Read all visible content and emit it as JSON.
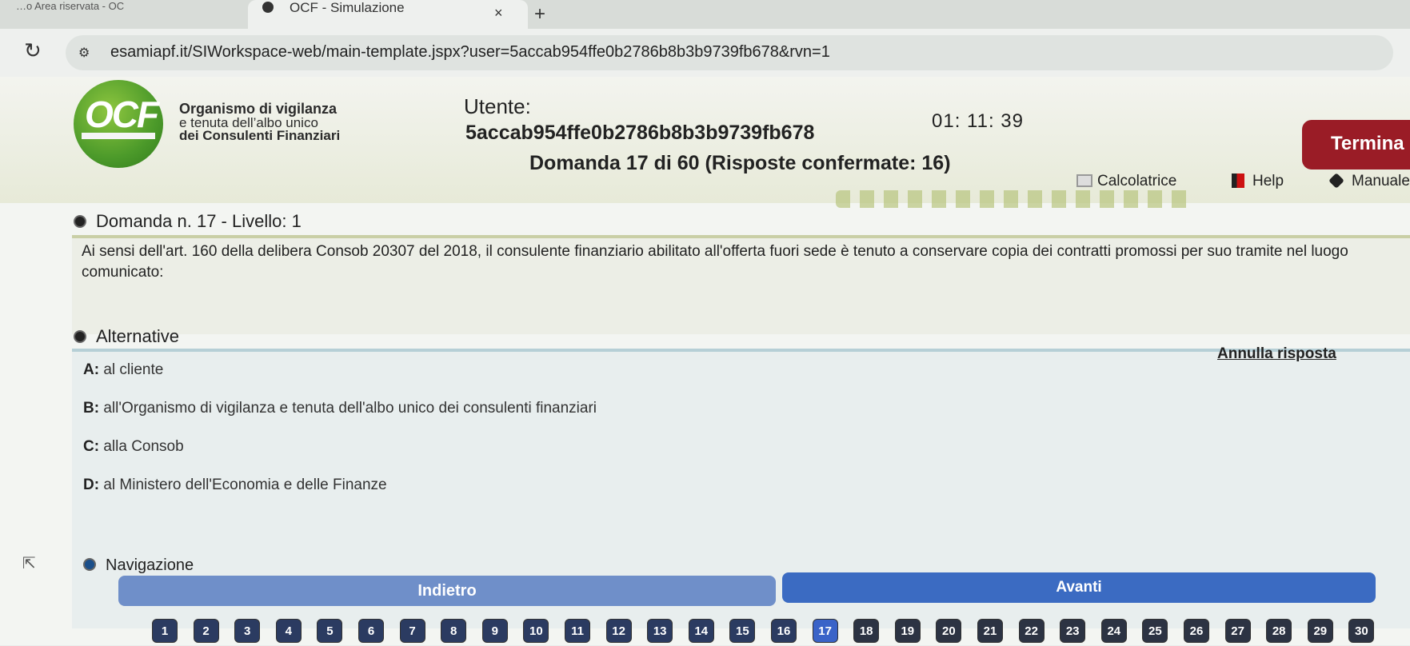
{
  "browser": {
    "prev_tab": "…o  Area riservata - OC",
    "tab_title": "OCF - Simulazione",
    "tab_close": "×",
    "new_tab": "+",
    "url": "esamiapf.it/SIWorkspace-web/main-template.jspx?user=5accab954ffe0b2786b8b3b9739fb678&rvn=1"
  },
  "header": {
    "logo_text": "OCF",
    "org_line1": "Organismo di vigilanza",
    "org_line2": "e tenuta dell’albo unico",
    "org_line3": "dei Consulenti Finanziari",
    "utente_label": "Utente:",
    "utente_id": "5accab954ffe0b2786b8b3b9739fb678",
    "timer": "01: 11: 39",
    "termina": "Termina",
    "domanda_title": "Domanda 17 di 60 (Risposte confermate: 16)",
    "tools": {
      "calcolatrice": "Calcolatrice",
      "help": "Help",
      "manuale": "Manuale"
    }
  },
  "question": {
    "heading": "Domanda n. 17 - Livello: 1",
    "text": "Ai sensi dell'art. 160 della delibera Consob 20307 del 2018, il consulente finanziario abilitato all'offerta fuori sede è tenuto a conservare copia dei contratti promossi per suo tramite nel luogo comunicato:"
  },
  "alternatives": {
    "heading": "Alternative",
    "annulla": "Annulla risposta",
    "items": [
      {
        "key": "A:",
        "text": "al cliente"
      },
      {
        "key": "B:",
        "text": "all'Organismo di vigilanza e tenuta dell'albo unico dei consulenti finanziari"
      },
      {
        "key": "C:",
        "text": "alla Consob"
      },
      {
        "key": "D:",
        "text": "al Ministero dell'Economia e delle Finanze"
      }
    ]
  },
  "navigation": {
    "heading": "Navigazione",
    "back": "Indietro",
    "next": "Avanti",
    "current_question": 17,
    "numbers": [
      "1",
      "2",
      "3",
      "4",
      "5",
      "6",
      "7",
      "8",
      "9",
      "10",
      "11",
      "12",
      "13",
      "14",
      "15",
      "16",
      "17",
      "18",
      "19",
      "20",
      "21",
      "22",
      "23",
      "24",
      "25",
      "26",
      "27",
      "28",
      "29",
      "30"
    ]
  },
  "colors": {
    "termina": "#9a1c26",
    "nav_current": "#3a63c8",
    "nav_button": "#3b6bc2",
    "logo_green": "#4c9a2a"
  }
}
